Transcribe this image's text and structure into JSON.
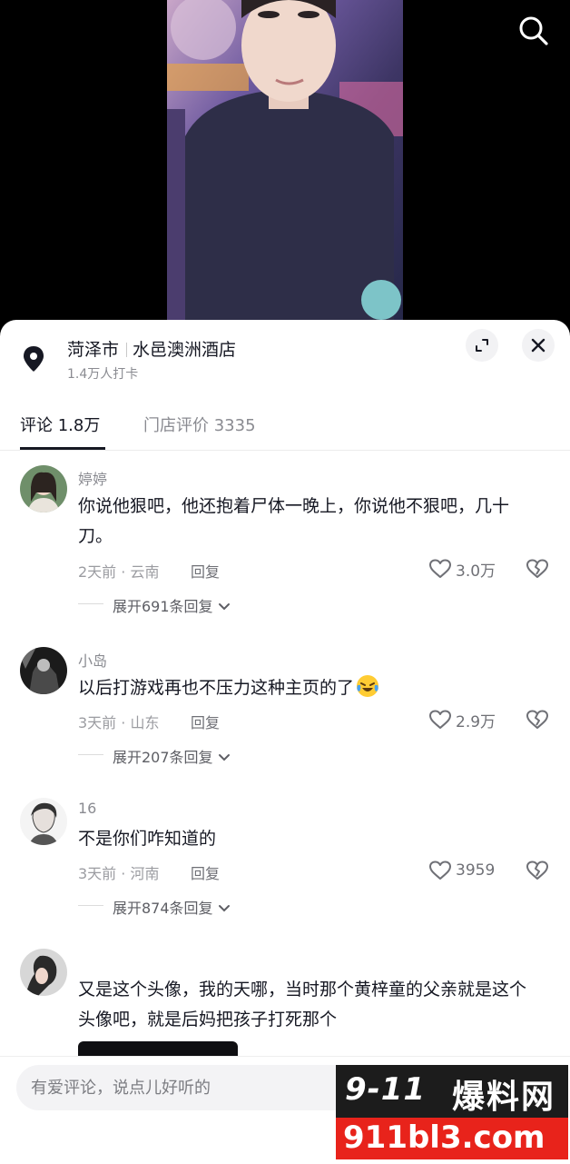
{
  "location": {
    "city": "菏泽市",
    "name": "水邑澳洲酒店",
    "checkins": "1.4万人打卡"
  },
  "tabs": [
    {
      "label": "评论 1.8万"
    },
    {
      "label": "门店评价 3335"
    }
  ],
  "comments": [
    {
      "user": "婷婷",
      "text": "你说他狠吧，他还抱着尸体一晚上，你说他不狠吧，几十刀。",
      "time": "2天前 · 云南",
      "reply": "回复",
      "likes": "3.0万",
      "expand": "展开691条回复"
    },
    {
      "user": "小岛",
      "text": "以后打游戏再也不压力这种主页的了",
      "time": "3天前 · 山东",
      "reply": "回复",
      "likes": "2.9万",
      "expand": "展开207条回复"
    },
    {
      "user": "16",
      "text": "不是你们咋知道的",
      "time": "3天前 · 河南",
      "reply": "回复",
      "likes": "3959",
      "expand": "展开874条回复"
    },
    {
      "user": "",
      "text": "又是这个头像，我的天哪，当时那个黄梓童的父亲就是这个头像吧，就是后妈把孩子打死那个"
    }
  ],
  "input": {
    "placeholder": "有爱评论，说点儿好听的"
  },
  "watermark": {
    "logo": "9-11",
    "name": "爆料网",
    "url": "911bl3.com"
  },
  "colors": {
    "accent_watermark": "#e8231b",
    "text_primary": "#161823",
    "text_secondary": "#8a8b91"
  }
}
